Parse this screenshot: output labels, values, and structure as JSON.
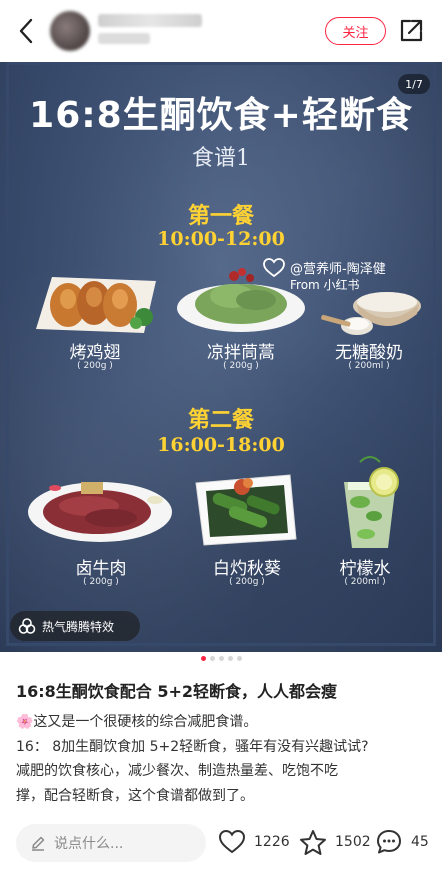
{
  "header": {
    "follow_label": "关注",
    "icons": {
      "back": "chevron-left-icon",
      "share": "share-icon"
    }
  },
  "hero": {
    "page_counter": "1/7",
    "title": "16:8生酮饮食+轻断食",
    "subtitle": "食谱1",
    "watermark_line1": "@营养师-陶泽健",
    "watermark_line2": "From 小红书",
    "meal1": {
      "title": "第一餐",
      "time": "10:00-12:00",
      "items": [
        {
          "name": "烤鸡翅",
          "weight": "( 200g )"
        },
        {
          "name": "凉拌茼蒿",
          "weight": "( 200g )"
        },
        {
          "name": "无糖酸奶",
          "weight": "( 200ml )"
        }
      ]
    },
    "meal2": {
      "title": "第二餐",
      "time": "16:00-18:00",
      "items": [
        {
          "name": "卤牛肉",
          "weight": "( 200g )"
        },
        {
          "name": "白灼秋葵",
          "weight": "( 200g )"
        },
        {
          "name": "柠檬水",
          "weight": "( 200ml )"
        }
      ]
    },
    "effect_chip": "热气腾腾特效"
  },
  "carousel": {
    "total": 5,
    "active_index": 0
  },
  "post": {
    "title": "16:8生酮饮食配合 5+2轻断食，人人都会瘦",
    "body_lines": [
      "🌸这又是一个很硬核的综合减肥食谱。",
      "16： 8加生酮饮食加 5+2轻断食，骚年有没有兴趣试试?",
      "减肥的饮食核心，减少餐次、制造热量差、吃饱不吃",
      "撑，配合轻断食，这个食谱都做到了。"
    ]
  },
  "bottom_bar": {
    "comment_placeholder": "说点什么...",
    "likes": "1226",
    "collects": "1502",
    "comments": "45"
  },
  "colors": {
    "accent": "#ff2442",
    "hero_bg": "#3e5173",
    "meal_title": "#ffd233"
  }
}
